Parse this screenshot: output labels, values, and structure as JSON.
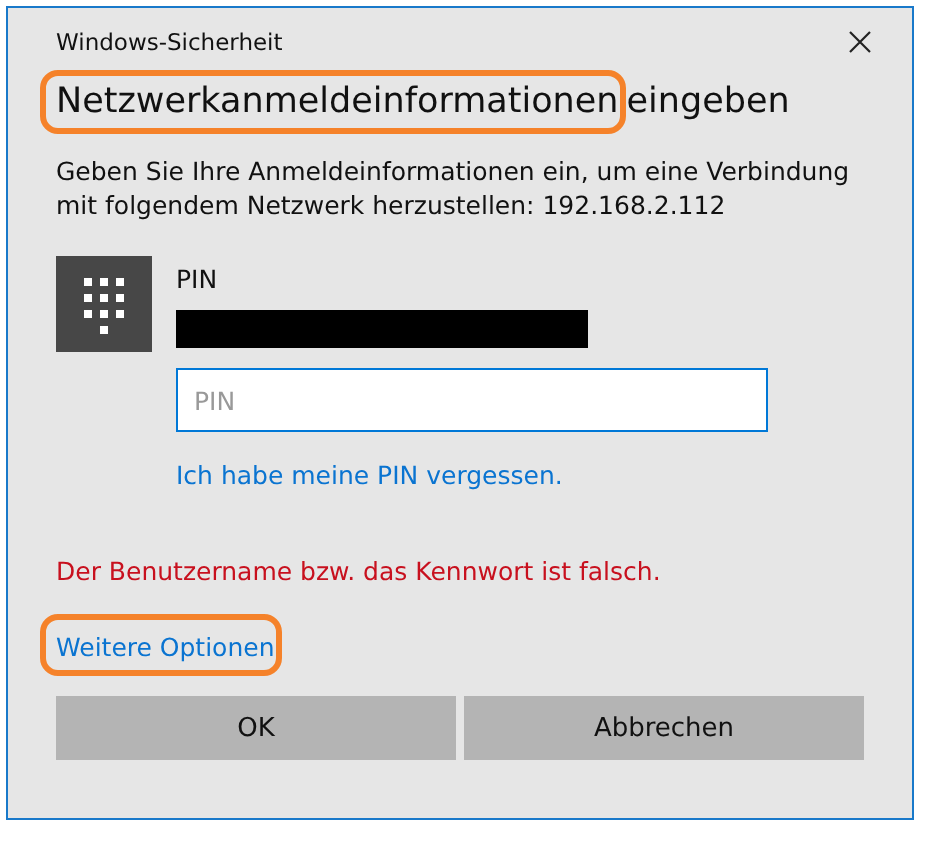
{
  "window": {
    "title": "Windows-Sicherheit"
  },
  "heading": [
    {
      "text": "Netzwerkanmeldeinformationen",
      "circled": true
    },
    {
      "text": "eingeben",
      "circled": false
    }
  ],
  "description": "Geben Sie Ihre Anmeldeinformationen ein, um eine Verbindung mit folgendem Netzwerk herzustellen: 192.168.2.112",
  "credential": {
    "label": "PIN",
    "field": {
      "placeholder": "PIN",
      "focused": true
    },
    "forgot_link": "Ich habe meine PIN vergessen."
  },
  "error": "Der Benutzername bzw. das Kennwort ist falsch.",
  "more_options": {
    "text": "Weitere Optionen",
    "circled": true
  },
  "buttons": [
    "OK",
    "Abbrechen"
  ]
}
